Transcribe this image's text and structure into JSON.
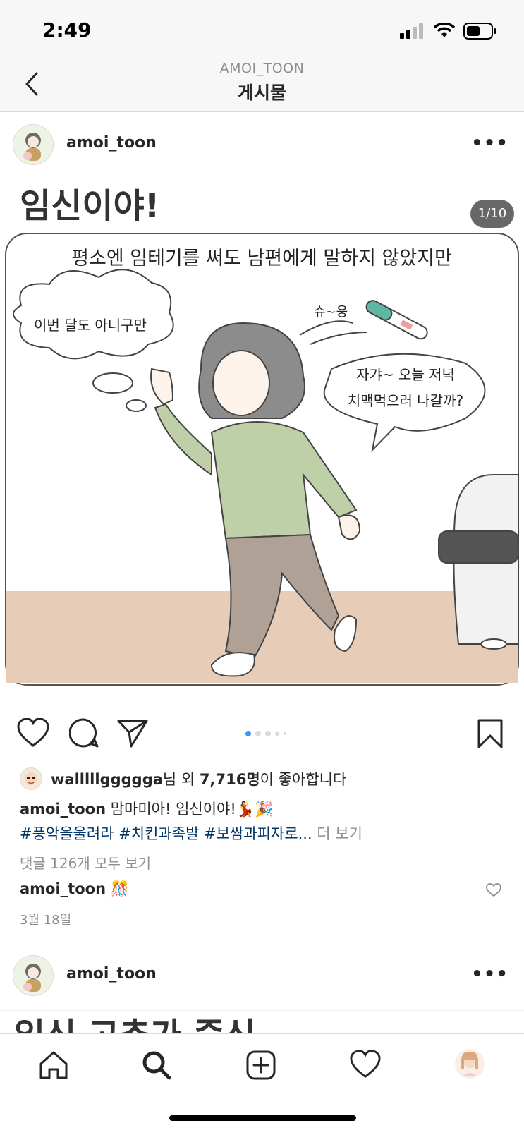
{
  "status": {
    "time": "2:49"
  },
  "nav": {
    "subtitle": "AMOI_TOON",
    "title": "게시물"
  },
  "post": {
    "username": "amoi_toon",
    "image_counter": "1/10",
    "comic": {
      "title": "임신이야!",
      "narration": "평소엔 임테기를 써도 남편에게 말하지 않았지만",
      "thought": "이번 달도 아니구만",
      "sfx": "슈~웅",
      "speech_line1": "자갸~ 오늘 저녁",
      "speech_line2": "치맥먹으러 나갈까?"
    },
    "carousel": {
      "count": 5,
      "active": 0
    },
    "likes": {
      "user": "walllllggggga",
      "mid": "님 외 ",
      "count": "7,716명",
      "suffix": "이 좋아합니다"
    },
    "caption": {
      "user": "amoi_toon",
      "text": "맘마미아! 임신이야!💃🎉"
    },
    "hashtags": {
      "text": "#풍악을울려라 #치킨과족발 #보쌈과피자로...",
      "more": "더 보기"
    },
    "view_comments": "댓글 126개 모두 보기",
    "comment": {
      "user": "amoi_toon",
      "text": "🎊"
    },
    "date": "3월 18일"
  },
  "next_post": {
    "username": "amoi_toon",
    "title_peek": "임신 고추가 중신"
  },
  "tabs": [
    "home-icon",
    "search-icon",
    "add-icon",
    "activity-heart-icon",
    "profile-avatar"
  ],
  "colors": {
    "link": "#003569",
    "accent": "#3897f0",
    "muted": "#8e8e8e"
  }
}
